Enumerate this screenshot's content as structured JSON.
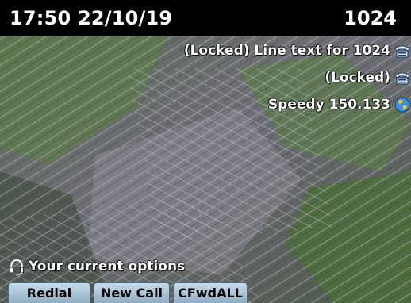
{
  "status_bar": {
    "datetime": "17:50 22/10/19",
    "extension": "1024"
  },
  "lines": [
    {
      "label": "(Locked) Line text for 1024",
      "icon": "desk-phone-icon"
    },
    {
      "label": "(Locked)",
      "icon": "desk-phone-icon"
    },
    {
      "label": "Speedy 150.133",
      "icon": "globe-icon"
    }
  ],
  "prompt": {
    "text": "Your current options",
    "icon": "headset-icon"
  },
  "softkeys": [
    {
      "label": "Redial"
    },
    {
      "label": "New Call"
    },
    {
      "label": "CFwdALL"
    }
  ],
  "colors": {
    "status_bar_bg": "#000000",
    "softkey_bg": "#a9c4d7",
    "text": "#ffffff"
  }
}
